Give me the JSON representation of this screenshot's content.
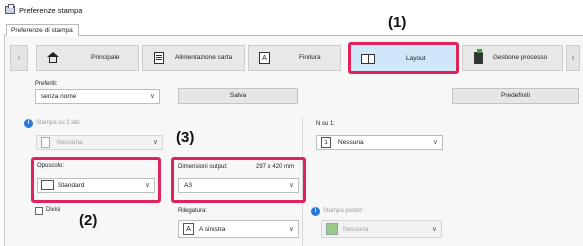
{
  "window": {
    "title": "Preferenze stampa"
  },
  "doc_tab": {
    "label": "Preferenze di stampa"
  },
  "tabs": {
    "principale": "Principale",
    "alimentazione": "Alimentazione carta",
    "finitura": "Finitura",
    "layout": "Layout",
    "gestione": "Gestione processo"
  },
  "preferiti": {
    "label": "Preferiti:",
    "value": "senza nome",
    "save_label": "Salva",
    "defaults_label": "Predefiniti"
  },
  "duplex": {
    "label": "Stampa su 2 lati:",
    "value": "Nessuna"
  },
  "n_up": {
    "label": "N su 1:",
    "value": "Nessuna",
    "icon_text": "1"
  },
  "opuscolo": {
    "label": "Opuscolo:",
    "value": "Standard"
  },
  "output_size": {
    "label": "Dimensioni output:",
    "size_text": "297 x 420 mm",
    "value": "A3"
  },
  "rilegatura": {
    "label": "Rilegatura:",
    "value": "A sinistra"
  },
  "poster": {
    "label": "Stampa poster:",
    "value": "Nessuna"
  },
  "checkbox_label": "Divisi",
  "callouts": {
    "c1": "(1)",
    "c2": "(2)",
    "c3": "(3)"
  },
  "colors": {
    "highlight": "#e0235a",
    "active_tab_bg": "#cfe7f8",
    "info": "#2a79d8"
  }
}
